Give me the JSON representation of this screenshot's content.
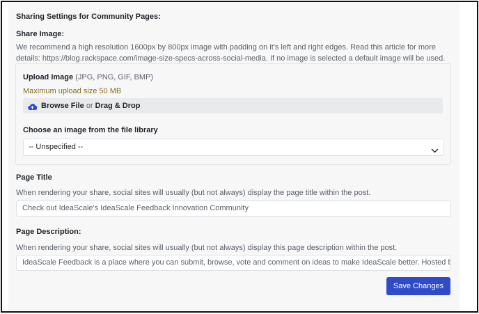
{
  "section_title": "Sharing Settings for Community Pages:",
  "share_image": {
    "label": "Share Image:",
    "description": "We recommend a high resolution 1600px by 800px image with padding on it's left and right edges. Read this article for more details: https://blog.rackspace.com/image-size-specs-across-social-media. If no image is selected a default image will be used.",
    "upload_label": "Upload Image",
    "upload_formats": "(JPG, PNG, GIF, BMP)",
    "max_size": "Maximum upload size 50 MB",
    "browse_label": "Browse File",
    "or_text": "or",
    "drag_label": "Drag & Drop",
    "library_label": "Choose an image from the file library",
    "library_selected": "-- Unspecified --"
  },
  "page_title": {
    "label": "Page Title",
    "help": "When rendering your share, social sites will usually (but not always) display the page title within the post.",
    "value": "Check out IdeaScale's IdeaScale Feedback Innovation Community"
  },
  "page_description": {
    "label": "Page Description:",
    "help": "When rendering your share, social sites will usually (but not always) display this page description within the post.",
    "value": "IdeaScale Feedback is a place where you can submit, browse, vote and comment on ideas to make IdeaScale better. Hosted by IdeaScale"
  },
  "save_button": "Save Changes",
  "colors": {
    "accent": "#2f4bc9",
    "max_size_text": "#8a6d1a",
    "panel_bg": "#f7f7f8"
  },
  "icons": {
    "upload": "cloud-upload-icon",
    "dropdown": "chevron-down-icon"
  }
}
